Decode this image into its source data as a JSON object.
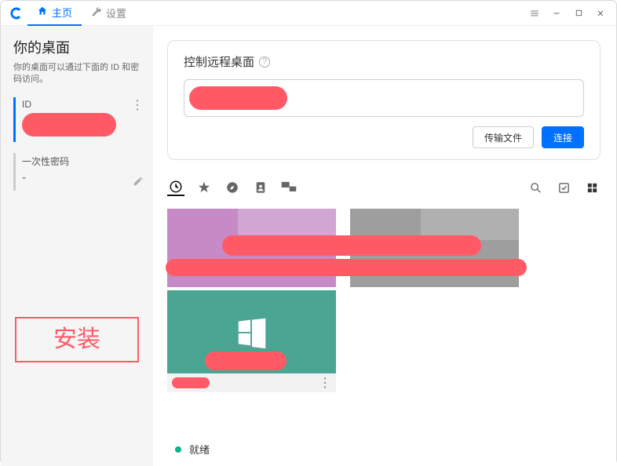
{
  "tabs": {
    "home": "主页",
    "settings": "设置"
  },
  "sidebar": {
    "title": "你的桌面",
    "desc": "你的桌面可以通过下面的 ID 和密码访问。",
    "id_label": "ID",
    "pw_label": "一次性密码",
    "pw_placeholder": "-"
  },
  "install_label": "安装",
  "remote": {
    "title": "控制远程桌面",
    "transfer_label": "传输文件",
    "connect_label": "连接"
  },
  "status": {
    "ready": "就绪"
  }
}
